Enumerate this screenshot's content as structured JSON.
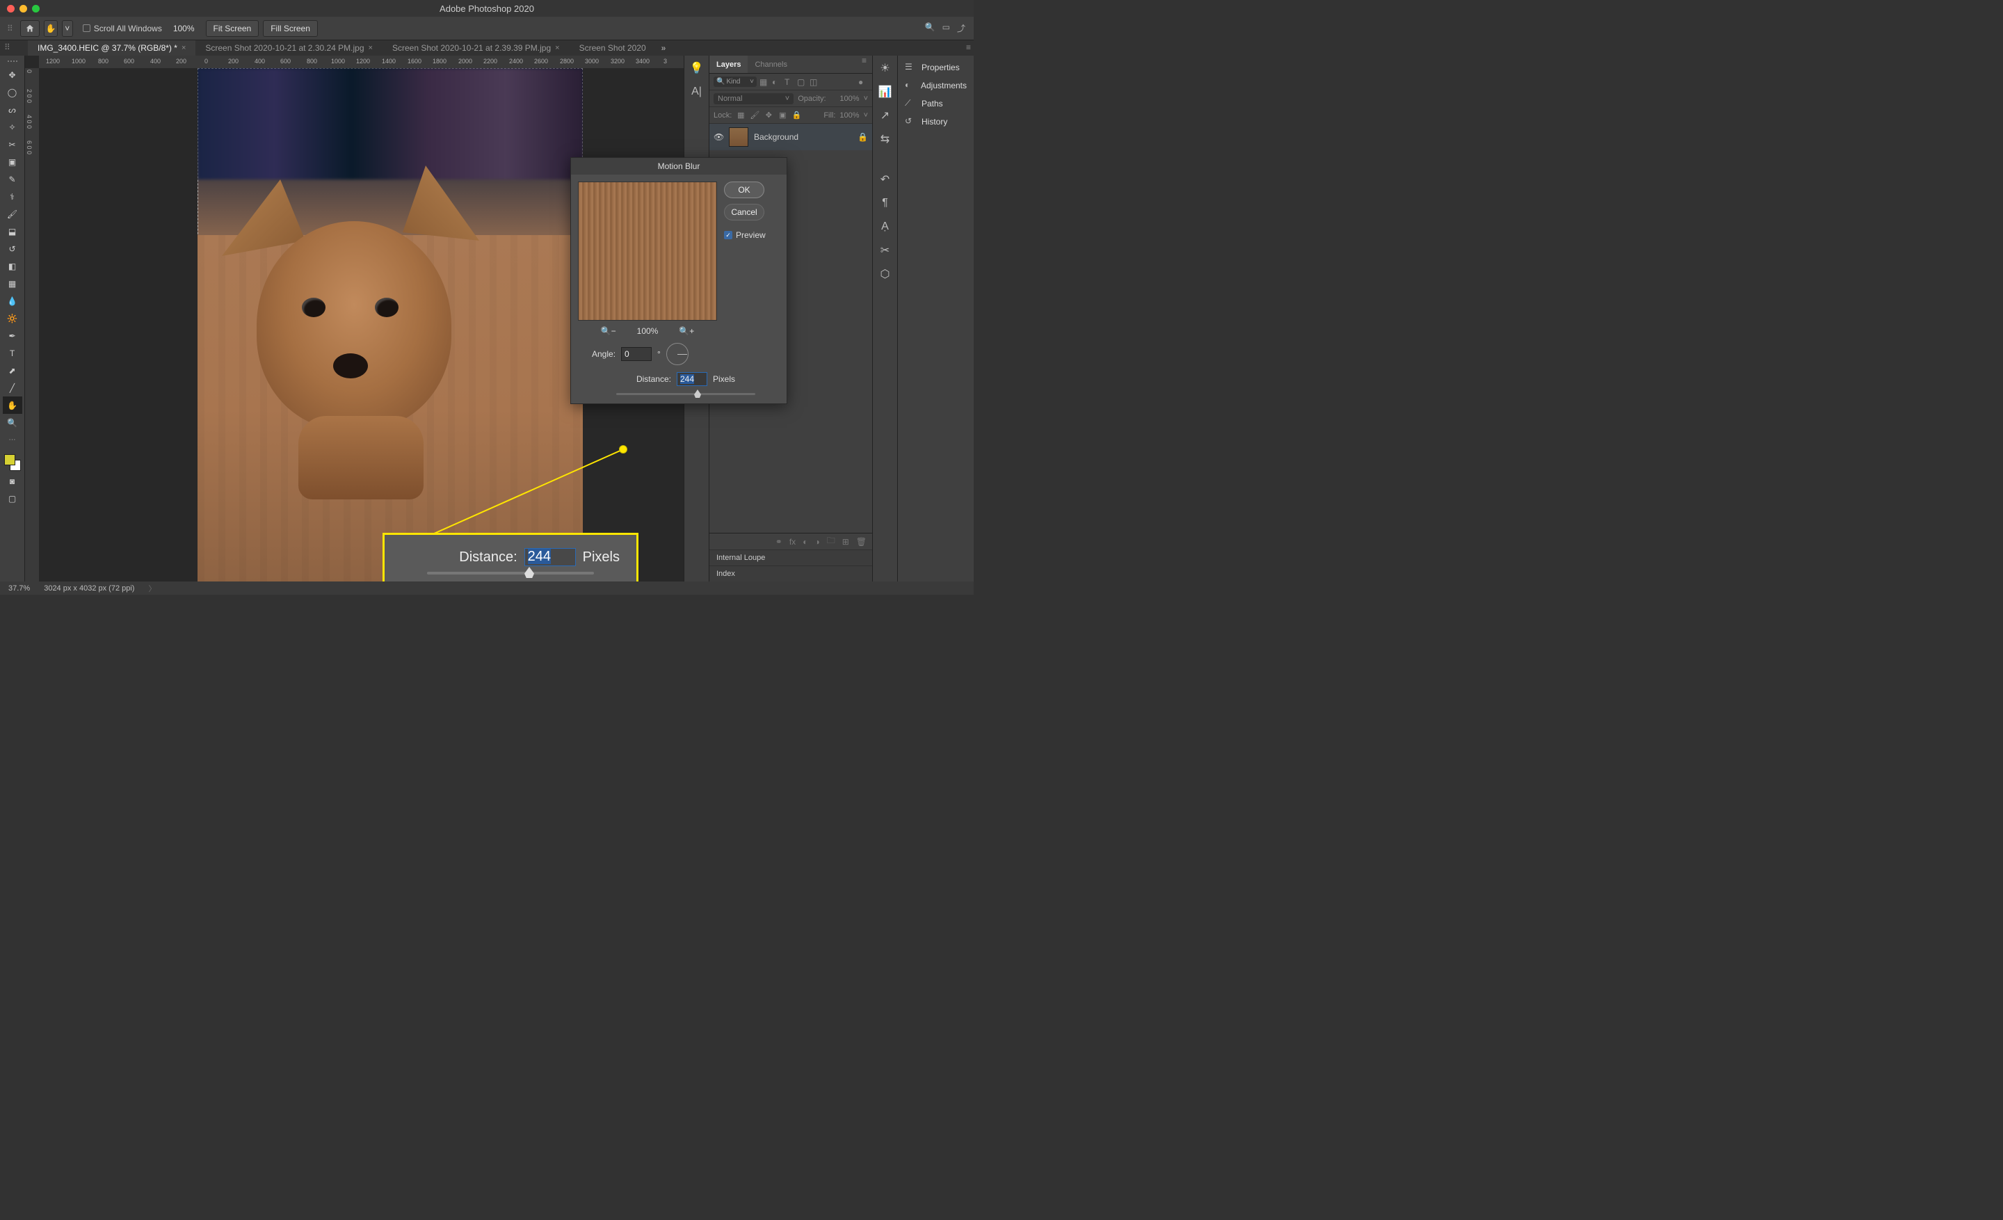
{
  "app_title": "Adobe Photoshop 2020",
  "options_bar": {
    "scroll_all_label": "Scroll All Windows",
    "zoom_label": "100%",
    "fit_screen": "Fit Screen",
    "fill_screen": "Fill Screen"
  },
  "tabs": [
    {
      "label": "IMG_3400.HEIC @ 37.7% (RGB/8*) *",
      "active": true
    },
    {
      "label": "Screen Shot 2020-10-21 at 2.30.24 PM.jpg",
      "active": false
    },
    {
      "label": "Screen Shot 2020-10-21 at 2.39.39 PM.jpg",
      "active": false
    },
    {
      "label": "Screen Shot 2020",
      "active": false
    }
  ],
  "ruler_h": [
    "1200",
    "1000",
    "800",
    "600",
    "400",
    "200",
    "0",
    "200",
    "400",
    "600",
    "800",
    "1000",
    "1200",
    "1400",
    "1600",
    "1800",
    "2000",
    "2200",
    "2400",
    "2600",
    "2800",
    "3000",
    "3200",
    "3400",
    "3"
  ],
  "ruler_v": [
    "0",
    "2\n0\n0",
    "4\n0\n0",
    "6\n0\n0"
  ],
  "panelB": {
    "tabs": [
      "Layers",
      "Channels"
    ],
    "kind_label": "Kind",
    "blend_mode": "Normal",
    "opacity_label": "Opacity:",
    "opacity_value": "100%",
    "lock_label": "Lock:",
    "fill_label": "Fill:",
    "fill_value": "100%",
    "layer_name": "Background",
    "internal_items": [
      "Internal Loupe",
      "Index"
    ]
  },
  "panelD": {
    "items": [
      "Properties",
      "Adjustments",
      "Paths",
      "History"
    ]
  },
  "dialog": {
    "title": "Motion Blur",
    "ok": "OK",
    "cancel": "Cancel",
    "preview_label": "Preview",
    "zoom_level": "100%",
    "angle_label": "Angle:",
    "angle_value": "0",
    "angle_unit": "°",
    "distance_label": "Distance:",
    "distance_value": "244",
    "distance_unit": "Pixels"
  },
  "callout": {
    "label": "Distance:",
    "value": "244",
    "unit": "Pixels"
  },
  "status": {
    "zoom": "37.7%",
    "doc": "3024 px x 4032 px (72 ppi)"
  }
}
